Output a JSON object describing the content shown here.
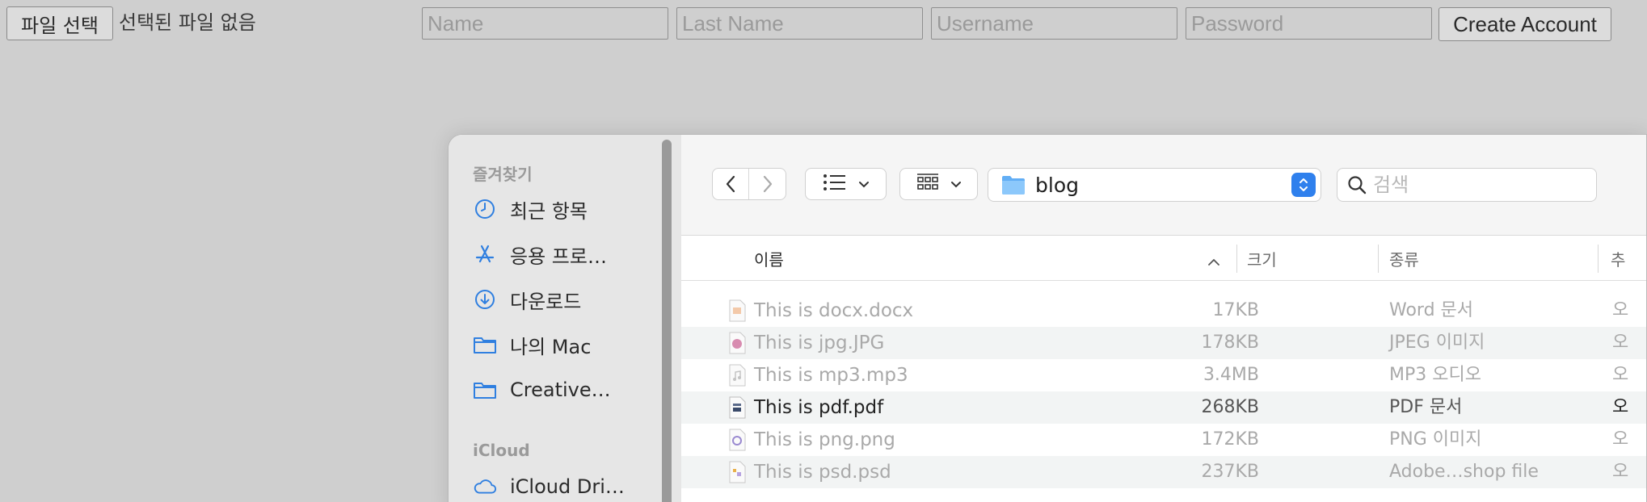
{
  "form": {
    "file_button_label": "파일 선택",
    "file_status": "선택된 파일 없음",
    "name_placeholder": "Name",
    "last_name_placeholder": "Last Name",
    "username_placeholder": "Username",
    "password_placeholder": "Password",
    "create_button_label": "Create Account"
  },
  "dialog": {
    "sidebar": {
      "favorites_heading": "즐겨찾기",
      "favorites": [
        {
          "label": "최근 항목",
          "icon": "clock-icon"
        },
        {
          "label": "응용 프로…",
          "icon": "app-store-icon"
        },
        {
          "label": "다운로드",
          "icon": "download-icon"
        },
        {
          "label": "나의 Mac",
          "icon": "folder-icon"
        },
        {
          "label": "Creative…",
          "icon": "folder-icon"
        }
      ],
      "icloud_heading": "iCloud",
      "icloud": [
        {
          "label": "iCloud Dri…",
          "icon": "cloud-icon"
        }
      ]
    },
    "toolbar": {
      "current_folder": "blog",
      "search_placeholder": "검색"
    },
    "columns": {
      "name": "이름",
      "size": "크기",
      "kind": "종류",
      "extra": "추"
    },
    "files": [
      {
        "name": "This is docx.docx",
        "size": "17KB",
        "kind": "Word 문서",
        "extra": "오",
        "enabled": false,
        "icon": "docx-file-icon"
      },
      {
        "name": "This is jpg.JPG",
        "size": "178KB",
        "kind": "JPEG 이미지",
        "extra": "오",
        "enabled": false,
        "icon": "jpg-file-icon"
      },
      {
        "name": "This is mp3.mp3",
        "size": "3.4MB",
        "kind": "MP3 오디오",
        "extra": "오",
        "enabled": false,
        "icon": "mp3-file-icon"
      },
      {
        "name": "This is pdf.pdf",
        "size": "268KB",
        "kind": "PDF 문서",
        "extra": "오",
        "enabled": true,
        "icon": "pdf-file-icon"
      },
      {
        "name": "This is png.png",
        "size": "172KB",
        "kind": "PNG 이미지",
        "extra": "오",
        "enabled": false,
        "icon": "png-file-icon"
      },
      {
        "name": "This is psd.psd",
        "size": "237KB",
        "kind": "Adobe…shop file",
        "extra": "오",
        "enabled": false,
        "icon": "psd-file-icon"
      }
    ]
  }
}
